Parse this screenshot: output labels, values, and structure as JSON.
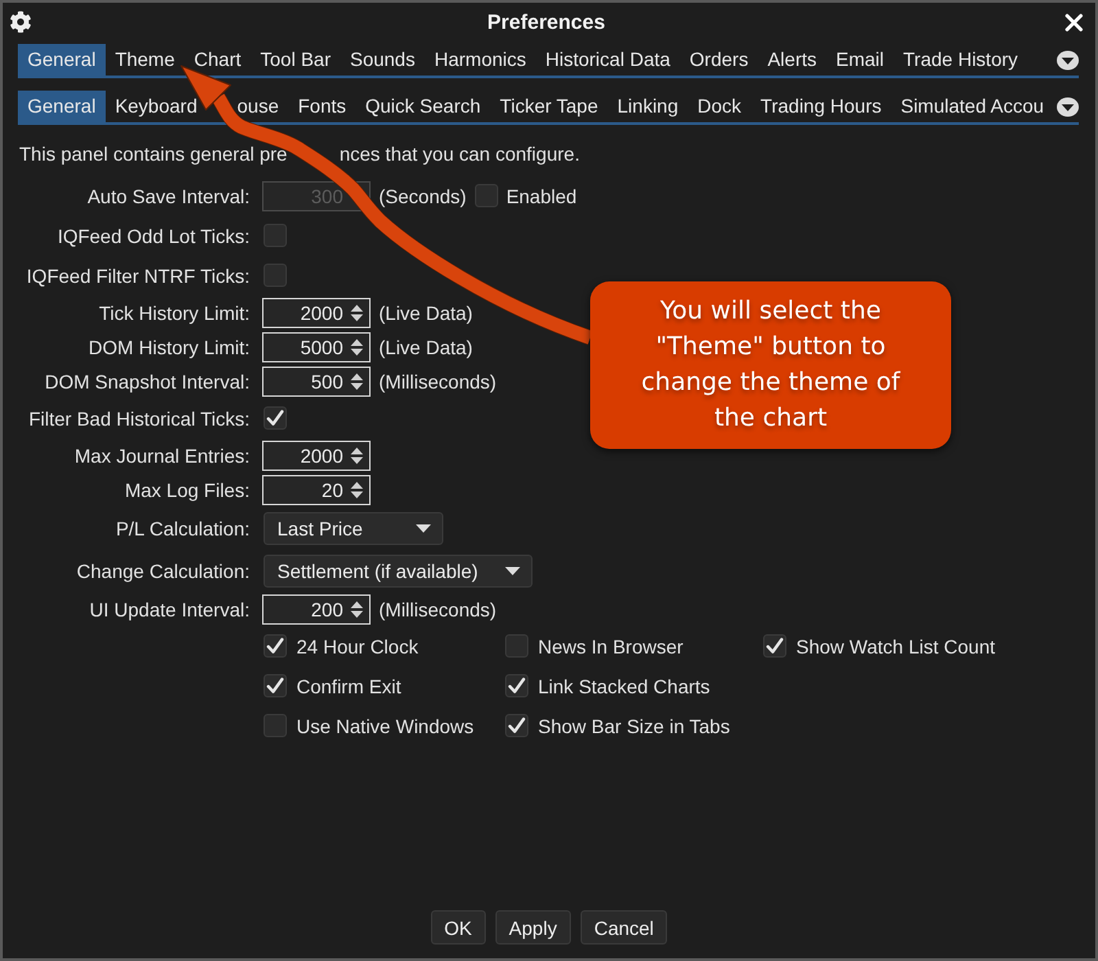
{
  "window": {
    "title": "Preferences"
  },
  "main_tabs": [
    {
      "label": "General",
      "selected": true
    },
    {
      "label": "Theme",
      "selected": false
    },
    {
      "label": "Chart",
      "selected": false
    },
    {
      "label": "Tool Bar",
      "selected": false
    },
    {
      "label": "Sounds",
      "selected": false
    },
    {
      "label": "Harmonics",
      "selected": false
    },
    {
      "label": "Historical Data",
      "selected": false
    },
    {
      "label": "Orders",
      "selected": false
    },
    {
      "label": "Alerts",
      "selected": false
    },
    {
      "label": "Email",
      "selected": false
    },
    {
      "label": "Trade History",
      "selected": false
    }
  ],
  "sub_tabs": [
    {
      "label": "General",
      "selected": true
    },
    {
      "label": "Keyboard",
      "selected": false
    },
    {
      "label": "ouse",
      "selected": false
    },
    {
      "label": "Fonts",
      "selected": false
    },
    {
      "label": "Quick Search",
      "selected": false
    },
    {
      "label": "Ticker Tape",
      "selected": false
    },
    {
      "label": "Linking",
      "selected": false
    },
    {
      "label": "Dock",
      "selected": false
    },
    {
      "label": "Trading Hours",
      "selected": false
    },
    {
      "label": "Simulated Accou",
      "selected": false
    }
  ],
  "description": [
    "This panel contains general pre",
    "nces that you can configure."
  ],
  "settings": [
    {
      "kind": "spinner",
      "label": "Auto Save Interval:",
      "value": "300",
      "disabled": true,
      "unit": "(Seconds)",
      "option": {
        "label": "Enabled",
        "checked": false
      }
    },
    {
      "kind": "checkbox",
      "label": "IQFeed Odd Lot Ticks:",
      "checked": false
    },
    {
      "kind": "checkbox",
      "label": "IQFeed Filter NTRF Ticks:",
      "checked": false
    },
    {
      "kind": "spinner",
      "label": "Tick History Limit:",
      "value": "2000",
      "disabled": false,
      "unit": "(Live Data)"
    },
    {
      "kind": "spinner",
      "label": "DOM History Limit:",
      "value": "5000",
      "disabled": false,
      "unit": "(Live Data)"
    },
    {
      "kind": "spinner",
      "label": "DOM Snapshot Interval:",
      "value": "500",
      "disabled": false,
      "unit": "(Milliseconds)"
    },
    {
      "kind": "checkbox",
      "label": "Filter Bad Historical Ticks:",
      "checked": true
    },
    {
      "kind": "spinner",
      "label": "Max Journal Entries:",
      "value": "2000",
      "disabled": false
    },
    {
      "kind": "spinner",
      "label": "Max Log Files:",
      "value": "20",
      "disabled": false
    },
    {
      "kind": "dropdown",
      "label": "P/L Calculation:",
      "value": "Last Price"
    },
    {
      "kind": "dropdown",
      "label": "Change Calculation:",
      "value": "Settlement (if available)"
    },
    {
      "kind": "spinner",
      "label": "UI Update Interval:",
      "value": "200",
      "disabled": false,
      "unit": "(Milliseconds)"
    }
  ],
  "option_columns": [
    {
      "items": [
        {
          "label": "24 Hour Clock",
          "checked": true
        },
        {
          "label": "Confirm Exit",
          "checked": true
        },
        {
          "label": "Use Native Windows",
          "checked": false
        }
      ]
    },
    {
      "items": [
        {
          "label": "News In Browser",
          "checked": false
        },
        {
          "label": "Link Stacked Charts",
          "checked": true
        },
        {
          "label": "Show Bar Size in Tabs",
          "checked": true
        }
      ]
    },
    {
      "items": [
        {
          "label": "Show Watch List Count",
          "checked": true
        }
      ]
    }
  ],
  "buttons": [
    "OK",
    "Apply",
    "Cancel"
  ],
  "callout": {
    "text": "You will select the \"Theme\" button to change the theme of the chart"
  }
}
